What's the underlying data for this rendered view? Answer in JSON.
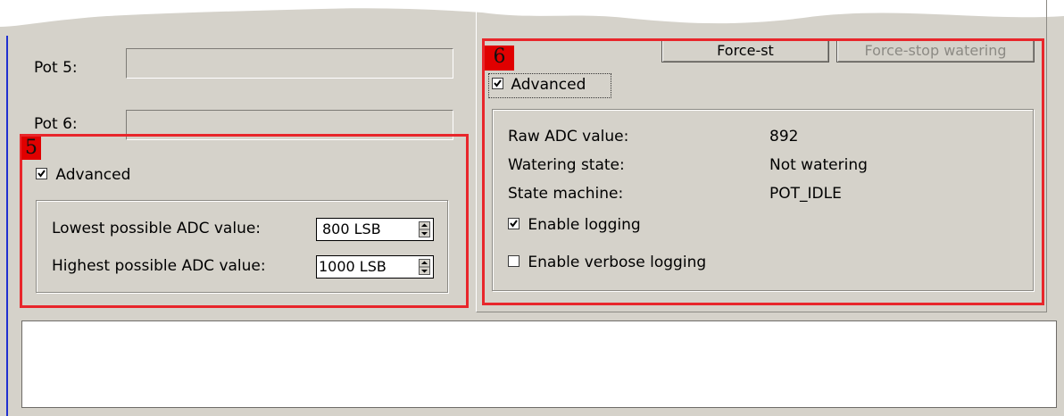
{
  "left_panel": {
    "pot5_label": "Pot 5:",
    "pot6_label": "Pot 6:",
    "marker": "5",
    "advanced_label": "Advanced",
    "advanced_checked": true,
    "lowest_label": "Lowest possible ADC value:",
    "lowest_value": "800 LSB",
    "highest_label": "Highest possible ADC value:",
    "highest_value": "1000 LSB"
  },
  "right_panel": {
    "marker": "6",
    "force_start_label": "Force-st",
    "force_stop_label": "Force-stop watering",
    "advanced_label": "Advanced",
    "advanced_checked": true,
    "raw_adc_label": "Raw ADC value:",
    "raw_adc_value": "892",
    "watering_state_label": "Watering state:",
    "watering_state_value": "Not watering",
    "state_machine_label": "State machine:",
    "state_machine_value": "POT_IDLE",
    "enable_logging_label": "Enable logging",
    "enable_logging_checked": true,
    "verbose_logging_label": "Enable verbose logging",
    "verbose_logging_checked": false
  },
  "colors": {
    "window_bg": "#d5d2ca",
    "highlight": "#e8262b",
    "marker_bg": "#e00000"
  }
}
